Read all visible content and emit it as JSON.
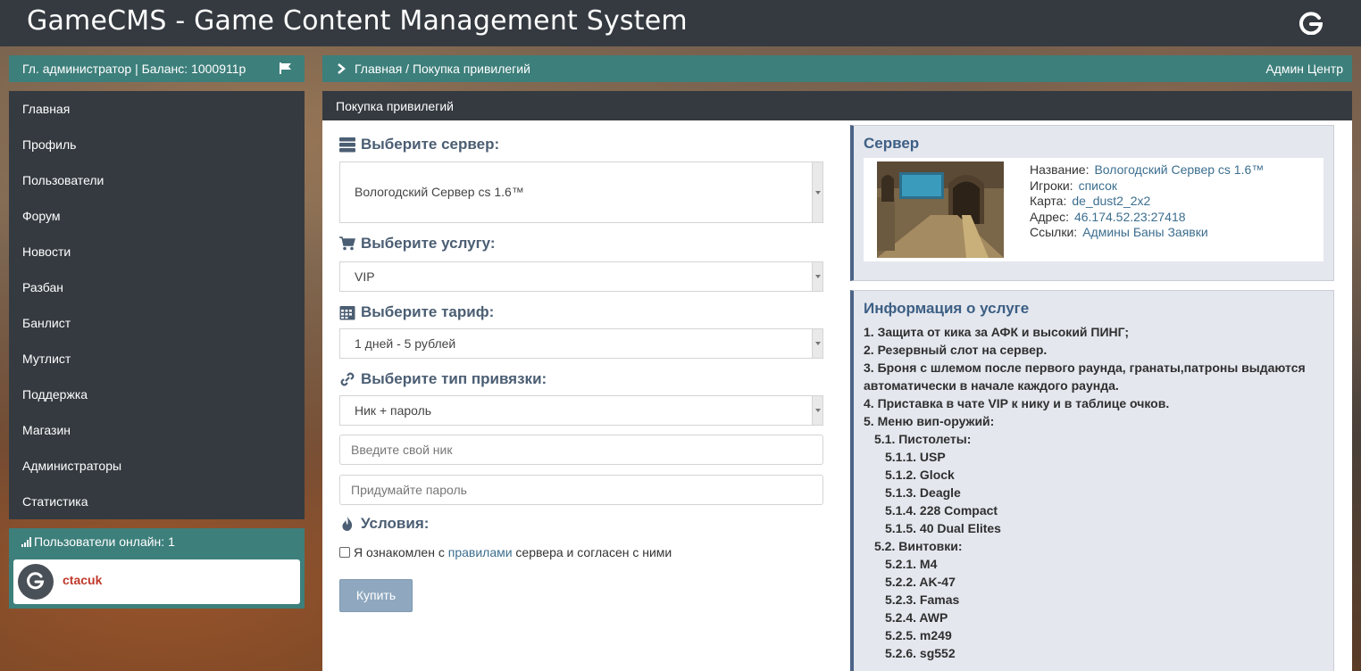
{
  "header": {
    "title": "GameCMS - Game Content Management System"
  },
  "user_bar": {
    "text": "Гл. администратор | Баланс: 1000911р"
  },
  "nav": {
    "items": [
      {
        "label": "Главная"
      },
      {
        "label": "Профиль"
      },
      {
        "label": "Пользователи"
      },
      {
        "label": "Форум"
      },
      {
        "label": "Новости"
      },
      {
        "label": "Разбан"
      },
      {
        "label": "Банлист"
      },
      {
        "label": "Мутлист"
      },
      {
        "label": "Поддержка"
      },
      {
        "label": "Магазин"
      },
      {
        "label": "Администраторы"
      },
      {
        "label": "Статистика"
      }
    ]
  },
  "online": {
    "header": "Пользователи онлайн: 1",
    "user": "ctacuk"
  },
  "breadcrumb": {
    "path": "Главная / Покупка привилегий",
    "admin_link": "Админ Центр"
  },
  "panel": {
    "title": "Покупка привилегий",
    "server_label": "Выберите сервер:",
    "server_value": "Вологодский Сервер cs 1.6™",
    "service_label": "Выберите услугу:",
    "service_value": "VIP",
    "tariff_label": "Выберите тариф:",
    "tariff_value": "1 дней - 5 рублей",
    "binding_label": "Выберите тип привязки:",
    "binding_value": "Ник + пароль",
    "nick_placeholder": "Введите свой ник",
    "password_placeholder": "Придумайте пароль",
    "terms_label": "Условия:",
    "terms_pre": "Я ознакомлен с ",
    "terms_link": "правилами",
    "terms_post": " сервера и согласен с ними",
    "buy_button": "Купить"
  },
  "server_card": {
    "title": "Сервер",
    "rows": [
      {
        "label": "Название:",
        "value": "Вологодский Сервер cs 1.6™"
      },
      {
        "label": "Игроки:",
        "value": "список"
      },
      {
        "label": "Карта:",
        "value": "de_dust2_2x2"
      },
      {
        "label": "Адрес:",
        "value": "46.174.52.23:27418"
      },
      {
        "label": "Ссылки:",
        "value": "Админы Баны Заявки"
      }
    ]
  },
  "service_card": {
    "title": "Информация о услуге",
    "lines": [
      {
        "text": "1. Защита от кика за АФК и высокий ПИНГ;",
        "level": 0
      },
      {
        "text": "2. Резервный слот на сервер.",
        "level": 0
      },
      {
        "text": "3. Броня с шлемом после первого раунда, гранаты,патроны выдаются",
        "level": 0
      },
      {
        "text": "автоматически в начале каждого раунда.",
        "level": 0
      },
      {
        "text": "4. Приставка в чате VIP к нику и в таблице очков.",
        "level": 0
      },
      {
        "text": "5. Меню вип-оружий:",
        "level": 0
      },
      {
        "text": "5.1. Пистолеты:",
        "level": 1
      },
      {
        "text": "5.1.1. USP",
        "level": 2
      },
      {
        "text": "5.1.2. Glock",
        "level": 2
      },
      {
        "text": "5.1.3. Deagle",
        "level": 2
      },
      {
        "text": "5.1.4. 228 Compact",
        "level": 2
      },
      {
        "text": "5.1.5. 40 Dual Elites",
        "level": 2
      },
      {
        "text": "5.2. Винтовки:",
        "level": 1
      },
      {
        "text": "5.2.1. M4",
        "level": 2
      },
      {
        "text": "5.2.2. AK-47",
        "level": 2
      },
      {
        "text": "5.2.3. Famas",
        "level": 2
      },
      {
        "text": "5.2.4. AWP",
        "level": 2
      },
      {
        "text": "5.2.5. m249",
        "level": 2
      },
      {
        "text": "5.2.6. sg552",
        "level": 2
      }
    ]
  },
  "colors": {
    "topbar": "#343a40",
    "teal": "#3d7f7b",
    "link": "#3c6e8f",
    "heading": "#4b5e73",
    "username": "#c0392b"
  }
}
